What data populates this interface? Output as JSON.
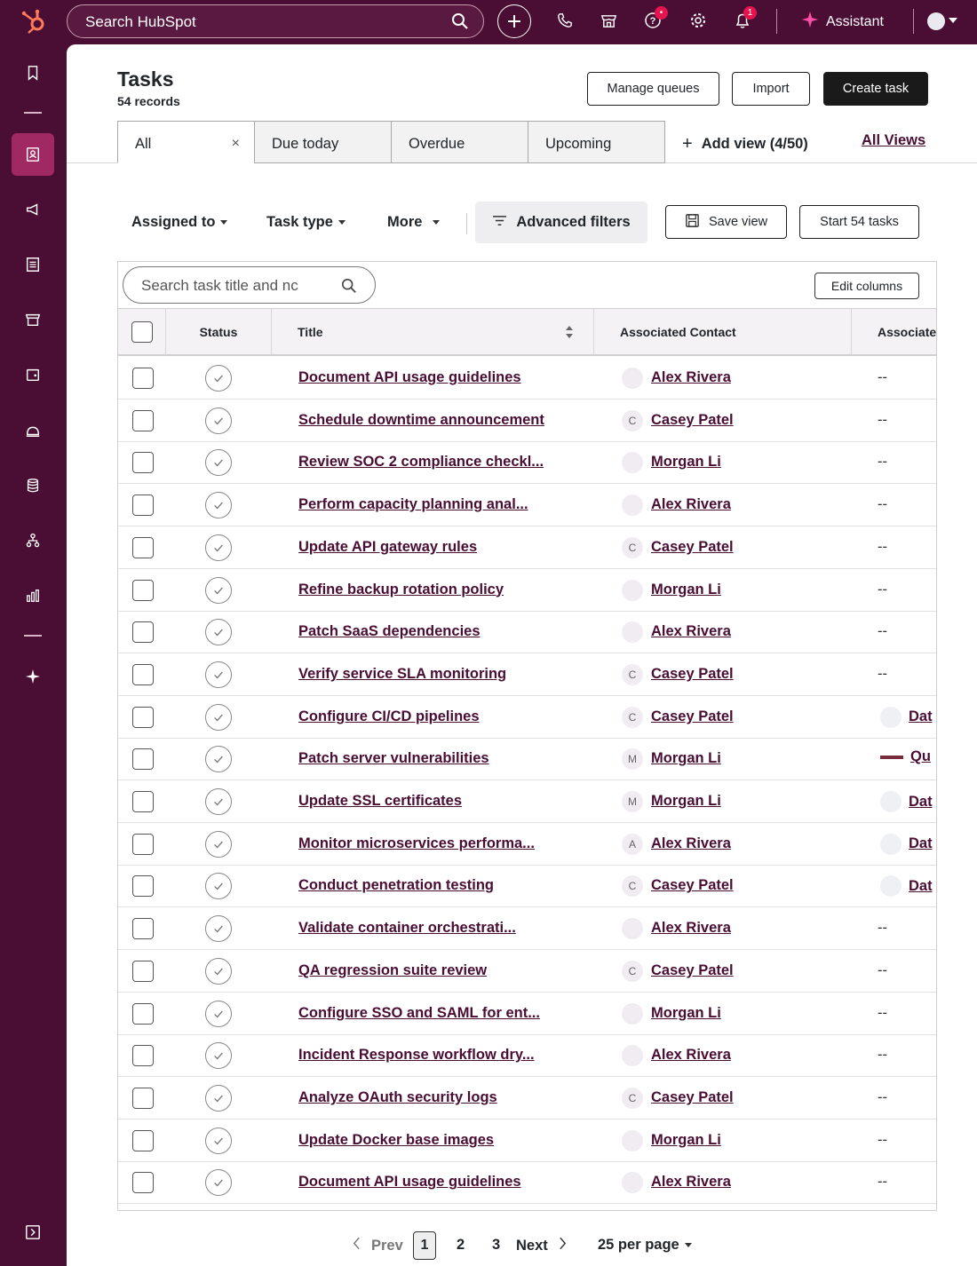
{
  "topbar": {
    "search_placeholder": "Search HubSpot",
    "assistant_label": "Assistant",
    "colors": {
      "bg": "#4a0d33",
      "badge": "#e5144f",
      "logo": "#ff7a59"
    },
    "badges": {
      "help": "•",
      "notifications": "1"
    }
  },
  "page": {
    "title": "Tasks",
    "subtitle": "54 records",
    "buttons": {
      "manage_queues": "Manage queues",
      "import": "Import",
      "create_task": "Create task"
    }
  },
  "tabs": [
    {
      "label": "All",
      "active": true
    },
    {
      "label": "Due today"
    },
    {
      "label": "Overdue"
    },
    {
      "label": "Upcoming"
    }
  ],
  "tab_close": "×",
  "add_view": "Add view (4/50)",
  "all_views": "All Views",
  "filters": {
    "assigned_to": "Assigned to",
    "task_type": "Task type",
    "more": "More",
    "advanced": "Advanced filters",
    "save_view": "Save view",
    "start_tasks": "Start 54 tasks"
  },
  "table": {
    "search_placeholder": "Search task title and nc",
    "edit_columns": "Edit columns",
    "columns": {
      "status": "Status",
      "title": "Title",
      "contact": "Associated Contact",
      "associate": "Associate"
    },
    "rows": [
      {
        "title": "Document API usage guidelines",
        "initial": "",
        "contact": "Alex Rivera",
        "assoc": "--",
        "company": ""
      },
      {
        "title": "Schedule downtime announcement",
        "initial": "C",
        "contact": "Casey Patel",
        "assoc": "--",
        "company": ""
      },
      {
        "title": "Review SOC 2 compliance checkl...",
        "initial": "",
        "contact": "Morgan Li",
        "assoc": "--",
        "company": ""
      },
      {
        "title": "Perform capacity planning anal...",
        "initial": "",
        "contact": "Alex Rivera",
        "assoc": "--",
        "company": ""
      },
      {
        "title": "Update API gateway rules",
        "initial": "C",
        "contact": "Casey Patel",
        "assoc": "--",
        "company": ""
      },
      {
        "title": "Refine backup rotation policy",
        "initial": "",
        "contact": "Morgan Li",
        "assoc": "--",
        "company": ""
      },
      {
        "title": "Patch SaaS dependencies",
        "initial": "",
        "contact": "Alex Rivera",
        "assoc": "--",
        "company": ""
      },
      {
        "title": "Verify service SLA monitoring",
        "initial": "C",
        "contact": "Casey Patel",
        "assoc": "--",
        "company": ""
      },
      {
        "title": "Configure CI/CD pipelines",
        "initial": "C",
        "contact": "Casey Patel",
        "assoc": "",
        "company": "Dat"
      },
      {
        "title": "Patch server vulnerabilities",
        "initial": "M",
        "contact": "Morgan Li",
        "assoc": "",
        "company": "Qu"
      },
      {
        "title": "Update SSL certificates",
        "initial": "M",
        "contact": "Morgan Li",
        "assoc": "",
        "company": "Dat"
      },
      {
        "title": "Monitor microservices performa...",
        "initial": "A",
        "contact": "Alex Rivera",
        "assoc": "",
        "company": "Dat"
      },
      {
        "title": "Conduct penetration testing",
        "initial": "C",
        "contact": "Casey Patel",
        "assoc": "",
        "company": "Dat"
      },
      {
        "title": "Validate container orchestrati...",
        "initial": "",
        "contact": "Alex Rivera",
        "assoc": "--",
        "company": ""
      },
      {
        "title": "QA regression suite review",
        "initial": "C",
        "contact": "Casey Patel",
        "assoc": "--",
        "company": ""
      },
      {
        "title": "Configure SSO and SAML for ent...",
        "initial": "",
        "contact": "Morgan Li",
        "assoc": "--",
        "company": ""
      },
      {
        "title": "Incident Response workflow dry...",
        "initial": "",
        "contact": "Alex Rivera",
        "assoc": "--",
        "company": ""
      },
      {
        "title": "Analyze OAuth security logs",
        "initial": "C",
        "contact": "Casey Patel",
        "assoc": "--",
        "company": ""
      },
      {
        "title": "Update Docker base images",
        "initial": "",
        "contact": "Morgan Li",
        "assoc": "--",
        "company": ""
      },
      {
        "title": "Document API usage guidelines",
        "initial": "",
        "contact": "Alex Rivera",
        "assoc": "--",
        "company": ""
      }
    ]
  },
  "pagination": {
    "prev": "Prev",
    "pages": [
      "1",
      "2",
      "3"
    ],
    "current": "1",
    "next": "Next",
    "per_page": "25 per page"
  }
}
